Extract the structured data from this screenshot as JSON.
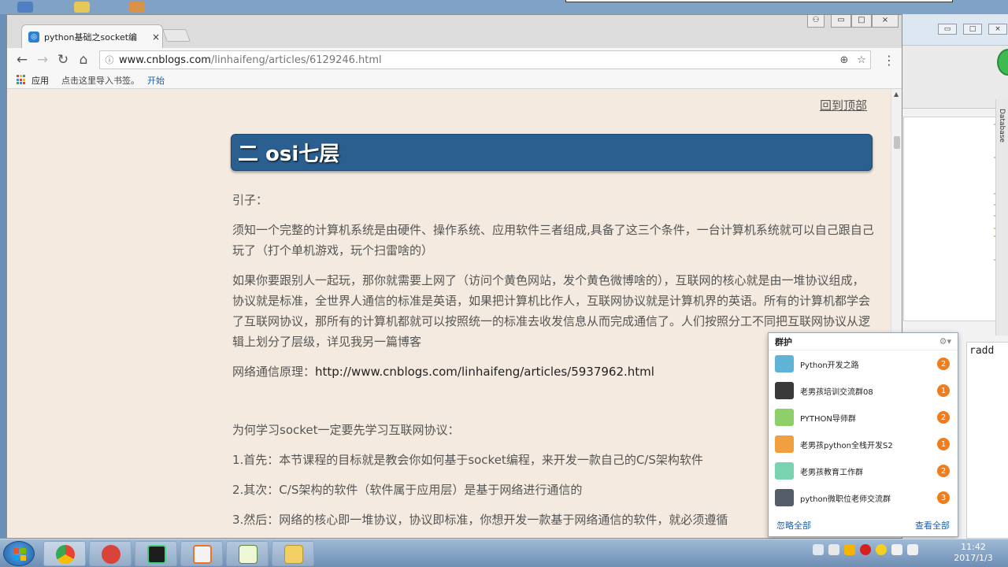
{
  "browser": {
    "tab_title": "python基础之socket编",
    "tab_close": "×",
    "url_domain": "www.cnblogs.com",
    "url_path": "/linhaifeng/articles/6129246.html",
    "bookmarks": {
      "apps_label": "应用",
      "import_text": "点击这里导入书签。",
      "start_label": "开始"
    }
  },
  "page": {
    "back_to_top": "回到顶部",
    "heading": "二 osi七层",
    "paragraphs": [
      "引子：",
      "须知一个完整的计算机系统是由硬件、操作系统、应用软件三者组成,具备了这三个条件，一台计算机系统就可以自己跟自己玩了（打个单机游戏，玩个扫雷啥的）",
      "如果你要跟别人一起玩，那你就需要上网了（访问个黄色网站，发个黄色微博啥的），互联网的核心就是由一堆协议组成，协议就是标准，全世界人通信的标准是英语，如果把计算机比作人，互联网协议就是计算机界的英语。所有的计算机都学会了互联网协议，那所有的计算机都就可以按照统一的标准去收发信息从而完成通信了。人们按照分工不同把互联网协议从逻辑上划分了层级，详见我另一篇博客"
    ],
    "link_label": "网络通信原理：",
    "link_url": "http://www.cnblogs.com/linhaifeng/articles/5937962.html",
    "question": "为何学习socket一定要先学习互联网协议：",
    "points": [
      "1.首先：本节课程的目标就是教会你如何基于socket编程，来开发一款自己的C/S架构软件",
      "2.其次：C/S架构的软件（软件属于应用层）是基于网络进行通信的",
      "3.然后：网络的核心即一堆协议，协议即标准，你想开发一款基于网络通信的软件，就必须遵循"
    ]
  },
  "qq_popup": {
    "title": "群护",
    "items": [
      {
        "name": "Python开发之路",
        "count": "2"
      },
      {
        "name": "老男孩培训交流群08",
        "count": "1"
      },
      {
        "name": "PYTHON导师群",
        "count": "2"
      },
      {
        "name": "老男孩python全栈开发S2",
        "count": "1"
      },
      {
        "name": "老男孩教育工作群",
        "count": "2"
      },
      {
        "name": "python微职位老师交流群",
        "count": "3"
      }
    ],
    "ignore_all": "忽略全部",
    "view_all": "查看全部"
  },
  "ide": {
    "side_tab": "Database",
    "run_text": "radd"
  },
  "taskbar": {
    "time": "11:42",
    "date": "2017/1/3"
  },
  "colors": {
    "heading_bg": "#2a5f8f",
    "page_bg": "#f4eadf",
    "badge": "#f07d1a",
    "link_blue": "#1a5fb4"
  }
}
